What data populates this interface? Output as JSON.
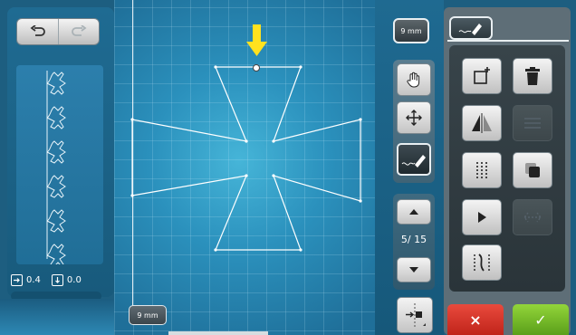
{
  "left_panel": {
    "offset_x": "0.4",
    "offset_y": "0.0",
    "motif_count": 6
  },
  "canvas": {
    "size_label": "9 mm"
  },
  "tools": {
    "size_label": "9 mm",
    "page_indicator": "5/ 15"
  },
  "actions": {
    "cancel_label": "×",
    "ok_label": "✓"
  },
  "colors": {
    "accent_yellow": "#ffe21f",
    "cancel_red": "#d6352a",
    "ok_green": "#78bf2a",
    "canvas_blue": "#2b91bd"
  },
  "icons": [
    "undo-icon",
    "redo-icon",
    "hand-icon",
    "move-arrows-icon",
    "pen-icon",
    "new-point-icon",
    "trash-icon",
    "mirror-icon",
    "align-icon",
    "stitch-grid-icon",
    "duplicate-icon",
    "play-icon",
    "split-icon",
    "path-edit-icon",
    "page-up-icon",
    "page-down-icon"
  ]
}
